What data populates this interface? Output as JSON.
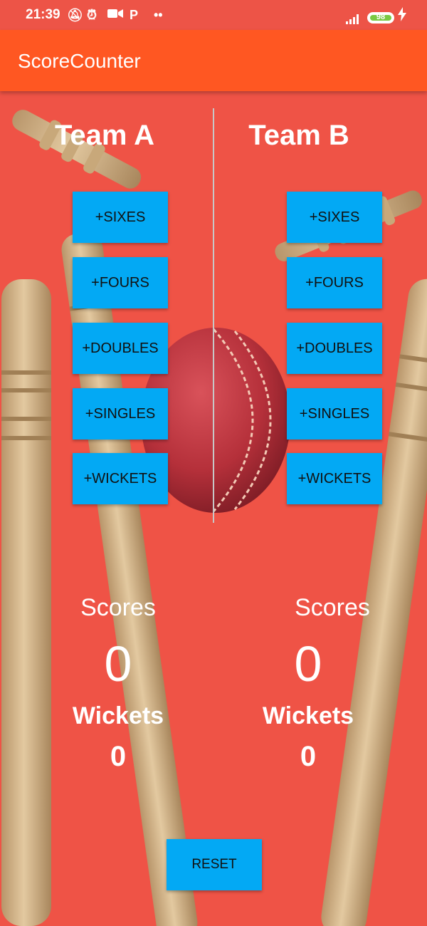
{
  "status_bar": {
    "time": "21:39",
    "icons": [
      "alarm-off-icon",
      "alarm-clock-icon",
      "video-camera-icon",
      "p-app-icon",
      "more-dots-icon",
      "signal-icon",
      "battery-icon",
      "charging-icon"
    ],
    "p_glyph": "P",
    "dots_glyph": "••",
    "battery_level": "98"
  },
  "app_bar": {
    "title": "ScoreCounter"
  },
  "team_a": {
    "title": "Team A",
    "buttons": [
      "+SIXES",
      "+FOURS",
      "+DOUBLES",
      "+SINGLES",
      "+WICKETS"
    ],
    "scores_label": "Scores",
    "score_value": "0",
    "wickets_label": "Wickets",
    "wickets_value": "0"
  },
  "team_b": {
    "title": "Team B",
    "buttons": [
      "+SIXES",
      "+FOURS",
      "+DOUBLES",
      "+SINGLES",
      "+WICKETS"
    ],
    "scores_label": "Scores",
    "score_value": "0",
    "wickets_label": "Wickets",
    "wickets_value": "0"
  },
  "reset_label": "RESET",
  "colors": {
    "background": "#ef5346",
    "app_bar": "#ff5722",
    "button": "#03a9f4",
    "stump_wood": "#d6b88c",
    "ball": "#b5303a"
  }
}
